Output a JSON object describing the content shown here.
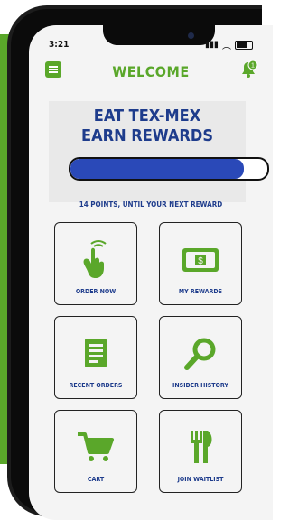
{
  "status": {
    "time": "3:21"
  },
  "header": {
    "title": "WELCOME",
    "notification_badge": "1"
  },
  "hero": {
    "line1": "EAT TEX-MEX",
    "line2": "EARN REWARDS"
  },
  "progress": {
    "fraction": 0.88
  },
  "points_text": "14 POINTS, UNTIL YOUR NEXT REWARD",
  "tiles": [
    {
      "label": "ORDER NOW"
    },
    {
      "label": "MY REWARDS"
    },
    {
      "label": "RECENT ORDERS"
    },
    {
      "label": "INSIDER HISTORY"
    },
    {
      "label": "CART"
    },
    {
      "label": "JOIN WAITLIST"
    }
  ],
  "colors": {
    "brand_green": "#5aa72a",
    "brand_blue": "#1e3c8c",
    "progress_blue": "#2a49b8"
  }
}
